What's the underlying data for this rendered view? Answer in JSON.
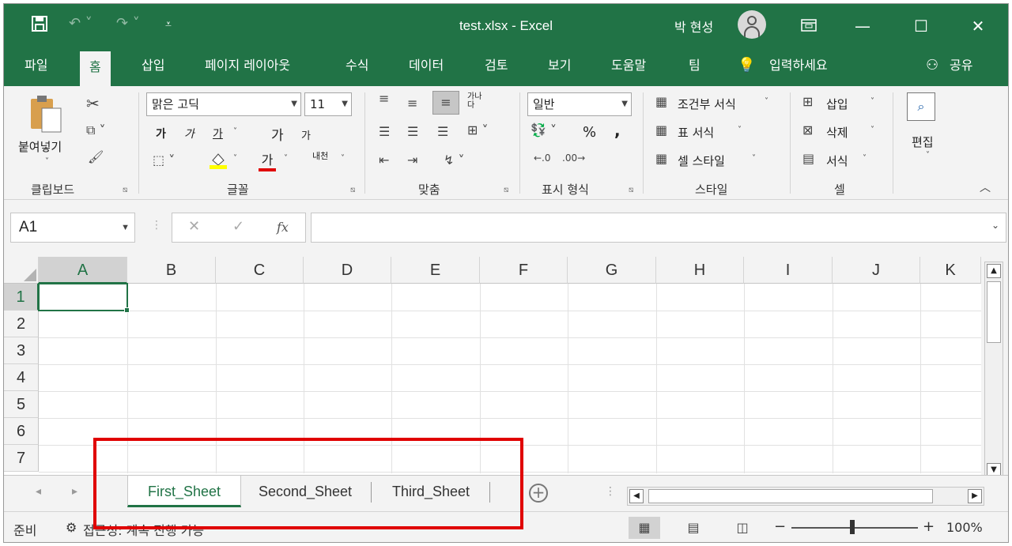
{
  "titlebar": {
    "title": "test.xlsx  -  Excel",
    "user": "박 현성",
    "save_icon": "save-icon",
    "undo_icon": "undo-icon",
    "redo_icon": "redo-icon",
    "customize_icon": "customize-qat-icon"
  },
  "tabs": [
    "파일",
    "홈",
    "삽입",
    "페이지 레이아웃",
    "수식",
    "데이터",
    "검토",
    "보기",
    "도움말",
    "팀"
  ],
  "tellme": "입력하세요",
  "share": "공유",
  "ribbon": {
    "clipboard": {
      "label": "클립보드",
      "paste": "붙여넣기"
    },
    "font": {
      "label": "글꼴",
      "family": "맑은 고딕",
      "size": "11",
      "bold": "가",
      "italic": "가",
      "underline": "가",
      "grow": "가",
      "shrink": "가",
      "fontcolor": "가",
      "phonetic": "내천"
    },
    "alignment": {
      "label": "맞춤",
      "orient": "가나다"
    },
    "number": {
      "label": "표시 형식",
      "format": "일반",
      "percent": "%",
      "comma": ","
    },
    "styles": {
      "label": "스타일",
      "conditional": "조건부 서식",
      "table": "표 서식",
      "cell": "셀 스타일"
    },
    "cells": {
      "label": "셀",
      "insert": "삽입",
      "delete": "삭제",
      "format": "서식"
    },
    "editing": {
      "label": "편집"
    }
  },
  "formula_bar": {
    "namebox": "A1",
    "fx": "fx",
    "value": ""
  },
  "grid": {
    "columns": [
      "A",
      "B",
      "C",
      "D",
      "E",
      "F",
      "G",
      "H",
      "I",
      "J",
      "K"
    ],
    "rows": [
      "1",
      "2",
      "3",
      "4",
      "5",
      "6",
      "7"
    ],
    "selected_cell": "A1"
  },
  "sheets": [
    "First_Sheet",
    "Second_Sheet",
    "Third_Sheet"
  ],
  "active_sheet": "First_Sheet",
  "status": {
    "ready": "준비",
    "accessibility": "접근성: 계속 진행 가능",
    "zoom": "100%",
    "zoom_minus": "−",
    "zoom_plus": "+"
  },
  "colors": {
    "accent": "#217346",
    "highlight": "#e00000"
  }
}
